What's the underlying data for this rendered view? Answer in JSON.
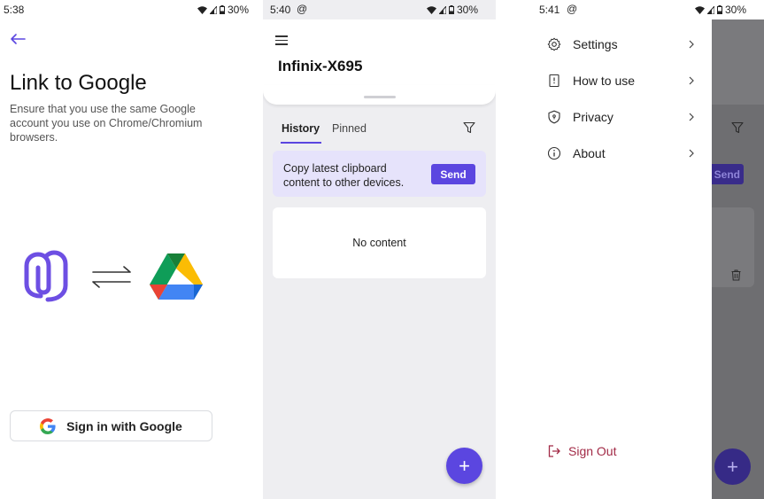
{
  "screen1": {
    "status": {
      "time": "5:38",
      "battery": "30%"
    },
    "title": "Link to Google",
    "description": "Ensure that you use the same Google account you use on Chrome/Chromium browsers.",
    "signin_label": "Sign in with Google"
  },
  "screen2": {
    "status": {
      "time": "5:40",
      "at": "@",
      "battery": "30%"
    },
    "device_name": "Infinix-X695",
    "tabs": [
      {
        "label": "History",
        "active": true
      },
      {
        "label": "Pinned",
        "active": false
      }
    ],
    "send_card": {
      "line1": "Copy latest clipboard",
      "line2": "content to other devices.",
      "button_label": "Send"
    },
    "empty_text": "No content",
    "fab_symbol": "+"
  },
  "screen3": {
    "status": {
      "time": "5:41",
      "at": "@",
      "battery": "30%"
    },
    "menu": [
      {
        "label": "Settings",
        "icon": "gear-icon"
      },
      {
        "label": "How to use",
        "icon": "book-icon"
      },
      {
        "label": "Privacy",
        "icon": "shield-icon"
      },
      {
        "label": "About",
        "icon": "info-icon"
      }
    ],
    "sign_out_label": "Sign Out",
    "background_send_label": "Send",
    "fab_symbol": "+"
  },
  "colors": {
    "accent": "#5b46e0",
    "send_card_bg": "#e6e3fb",
    "sign_out": "#a22a46",
    "screen2_bg": "#eeeef1"
  }
}
